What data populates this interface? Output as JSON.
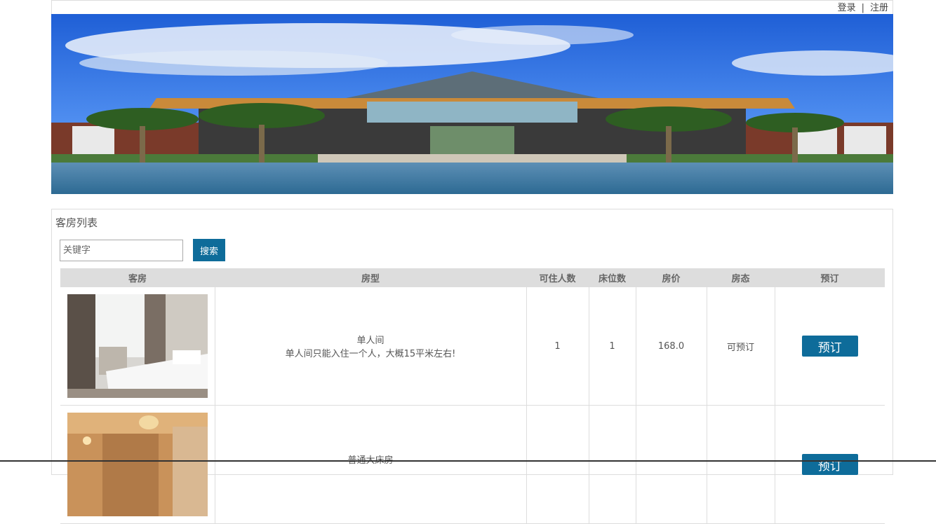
{
  "header": {
    "login": "登录",
    "separator": "|",
    "register": "注册"
  },
  "panel": {
    "title": "客房列表"
  },
  "search": {
    "placeholder": "关键字",
    "button": "搜索"
  },
  "table": {
    "headers": [
      "客房",
      "房型",
      "可住人数",
      "床位数",
      "房价",
      "房态",
      "预订"
    ],
    "rows": [
      {
        "type": "单人间",
        "desc": "单人间只能入住一个人，大概15平米左右!",
        "capacity": "1",
        "beds": "1",
        "price": "168.0",
        "status": "可预订",
        "action": "预订"
      },
      {
        "type": "普通大床房",
        "desc": "",
        "capacity": "",
        "beds": "",
        "price": "",
        "status": "",
        "action": "预订"
      }
    ]
  }
}
